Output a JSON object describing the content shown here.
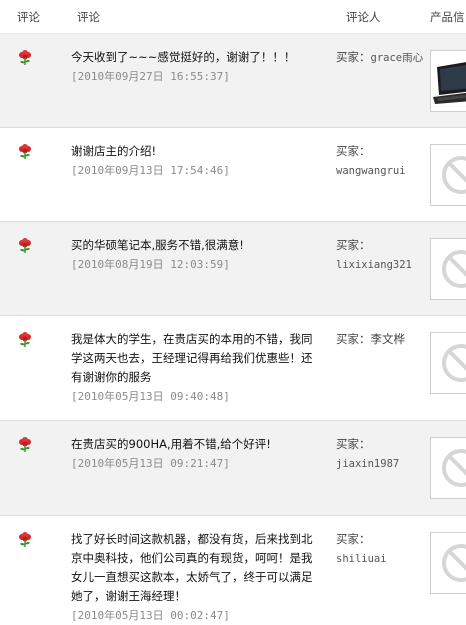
{
  "header": {
    "rating": "评论",
    "comment": "评论",
    "buyer": "评论人",
    "product": "产品信"
  },
  "reviews": [
    {
      "text": "今天收到了~~~感觉挺好的，谢谢了！！！",
      "date": "[2010年09月27日 16:55:37]",
      "buyer_label": "买家：",
      "buyer_name": "grace雨心",
      "thumb": "laptop-photo"
    },
    {
      "text": "谢谢店主的介绍!",
      "date": "[2010年09月13日 17:54:46]",
      "buyer_label": "买家：",
      "buyer_name": "wangwangrui",
      "thumb": "no-image-placeholder"
    },
    {
      "text": "买的华硕笔记本,服务不错,很满意!",
      "date": "[2010年08月19日 12:03:59]",
      "buyer_label": "买家：",
      "buyer_name": "lixixiang321",
      "thumb": "no-image-placeholder"
    },
    {
      "text": "我是体大的学生，在贵店买的本用的不错，我同学这两天也去，王经理记得再给我们优惠些！还有谢谢你的服务",
      "date": "[2010年05月13日 09:40:48]",
      "buyer_label": "买家：李文桦",
      "buyer_name": "",
      "thumb": "no-image-placeholder"
    },
    {
      "text": "在贵店买的900HA,用着不错,给个好评!",
      "date": "[2010年05月13日 09:21:47]",
      "buyer_label": "买家：",
      "buyer_name": "jiaxin1987",
      "thumb": "no-image-placeholder"
    },
    {
      "text": "找了好长时间这款机器，都没有货，后来找到北京中奥科技，他们公司真的有现货，呵呵！是我女儿一直想买这款本，太娇气了，终于可以满足她了，谢谢王海经理！",
      "date": "[2010年05月13日 00:02:47]",
      "buyer_label": "买家：",
      "buyer_name": "shiliuai",
      "thumb": "no-image-placeholder"
    }
  ],
  "colors": {
    "row_shaded": "#f3f2f3",
    "flower_red": "#d8262b",
    "flower_green": "#3c8f2a",
    "placeholder_gray": "#d6d6d6"
  }
}
